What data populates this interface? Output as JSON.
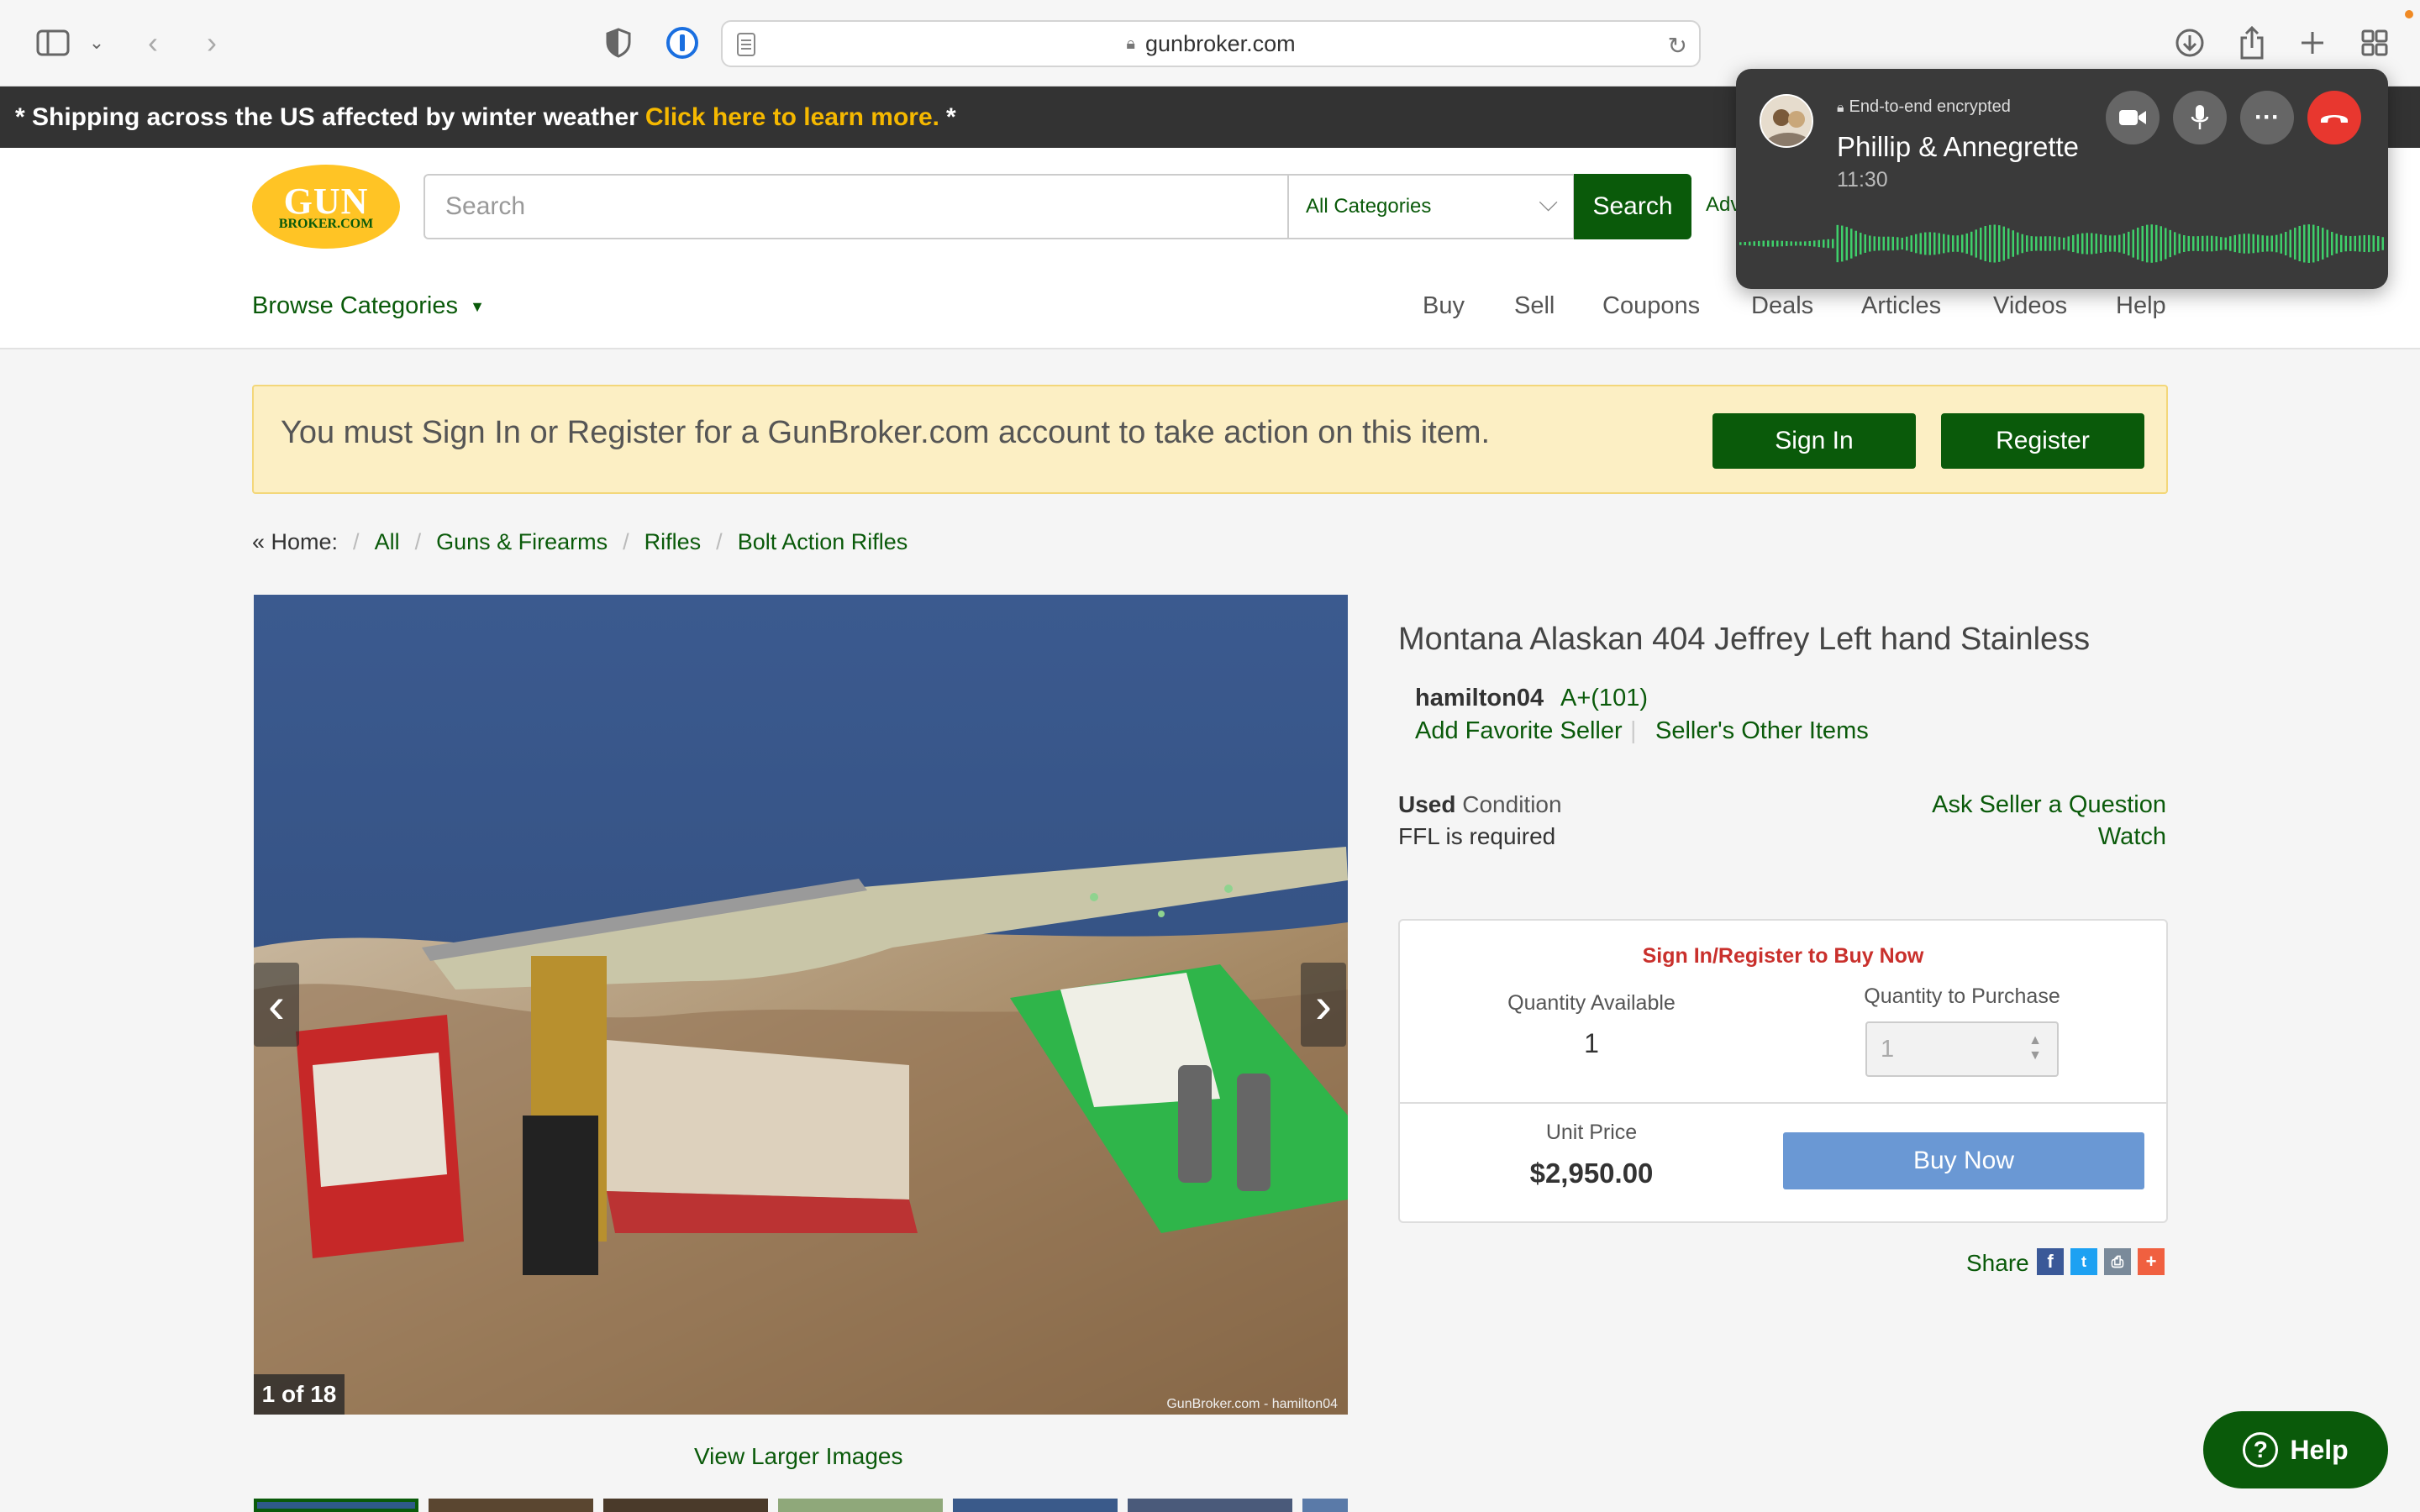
{
  "browser": {
    "url": "gunbroker.com"
  },
  "banner": {
    "text": "* Shipping across the US affected by winter weather",
    "link": "Click here to learn more.",
    "suffix": "*"
  },
  "header": {
    "logo_line1": "GUN",
    "logo_line2": "BROKER.COM",
    "search_placeholder": "Search",
    "category": "All Categories",
    "search_button": "Search",
    "advanced": "Adv",
    "browse": "Browse Categories",
    "nav": [
      "Buy",
      "Sell",
      "Coupons",
      "Deals",
      "Articles",
      "Videos",
      "Help"
    ]
  },
  "notice": {
    "text": "You must Sign In or Register for a GunBroker.com account to take action on this item.",
    "signin": "Sign In",
    "register": "Register"
  },
  "breadcrumb": {
    "home": "« Home:",
    "items": [
      "All",
      "Guns & Firearms",
      "Rifles",
      "Bolt Action Rifles"
    ]
  },
  "gallery": {
    "counter": "1 of 18",
    "watermark": "GunBroker.com - hamilton04",
    "view_larger": "View Larger Images"
  },
  "item": {
    "title": "Montana Alaskan 404 Jeffrey Left hand Stainless",
    "seller": "hamilton04",
    "rating": "A+(101)",
    "add_favorite": "Add Favorite Seller",
    "other_items": "Seller's Other Items",
    "condition_value": "Used",
    "condition_label": "Condition",
    "ffl": "FFL is required",
    "ask_question": "Ask Seller a Question",
    "watch": "Watch"
  },
  "buybox": {
    "header": "Sign In/Register to Buy Now",
    "qty_available_label": "Quantity Available",
    "qty_available": "1",
    "qty_purchase_label": "Quantity to Purchase",
    "qty_purchase": "1",
    "unit_price_label": "Unit Price",
    "unit_price": "$2,950.00",
    "buy_now": "Buy Now"
  },
  "share": {
    "label": "Share"
  },
  "help": {
    "label": "Help"
  },
  "facetime": {
    "encrypted": "End-to-end encrypted",
    "name": "Phillip & Annegrette",
    "time": "11:30"
  },
  "colors": {
    "brand_green": "#0a5a0a",
    "banner_link": "#f5b800",
    "notice_bg": "#fcefc4",
    "buy_now": "#6a98d4",
    "alert_red": "#c9302c",
    "end_call": "#e8372f"
  }
}
